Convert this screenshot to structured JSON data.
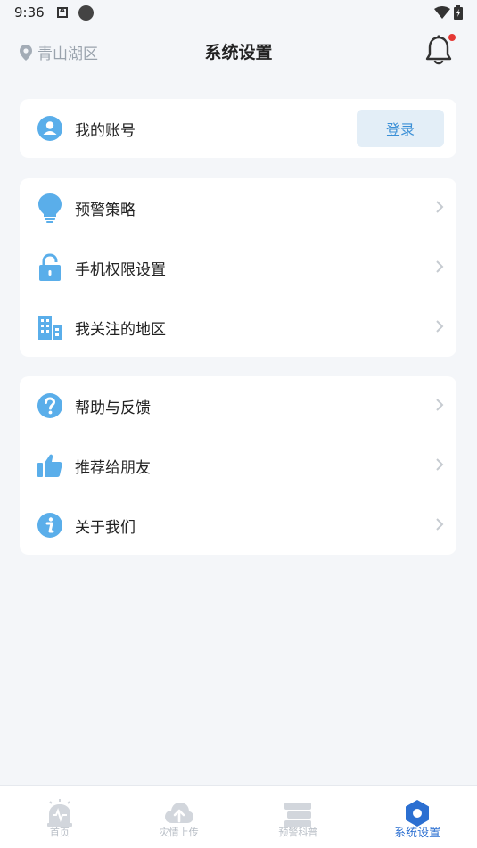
{
  "status_bar": {
    "time": "9:36"
  },
  "header": {
    "location": "青山湖区",
    "title": "系统设置"
  },
  "account": {
    "label": "我的账号",
    "login_button": "登录"
  },
  "group1": [
    {
      "label": "预警策略",
      "icon": "lightbulb-icon"
    },
    {
      "label": "手机权限设置",
      "icon": "lock-icon"
    },
    {
      "label": "我关注的地区",
      "icon": "building-icon"
    }
  ],
  "group2": [
    {
      "label": "帮助与反馈",
      "icon": "question-icon"
    },
    {
      "label": "推荐给朋友",
      "icon": "thumbs-up-icon"
    },
    {
      "label": "关于我们",
      "icon": "info-icon"
    }
  ],
  "tabbar": [
    {
      "label": "首页",
      "icon": "alarm-icon"
    },
    {
      "label": "灾情上传",
      "icon": "cloud-upload-icon"
    },
    {
      "label": "预警科普",
      "icon": "book-icon"
    },
    {
      "label": "系统设置",
      "icon": "settings-hexagon-icon",
      "active": true
    }
  ],
  "colors": {
    "accent": "#5aaeea",
    "active_tab": "#2b6fd1",
    "notification_dot": "#e53935"
  }
}
